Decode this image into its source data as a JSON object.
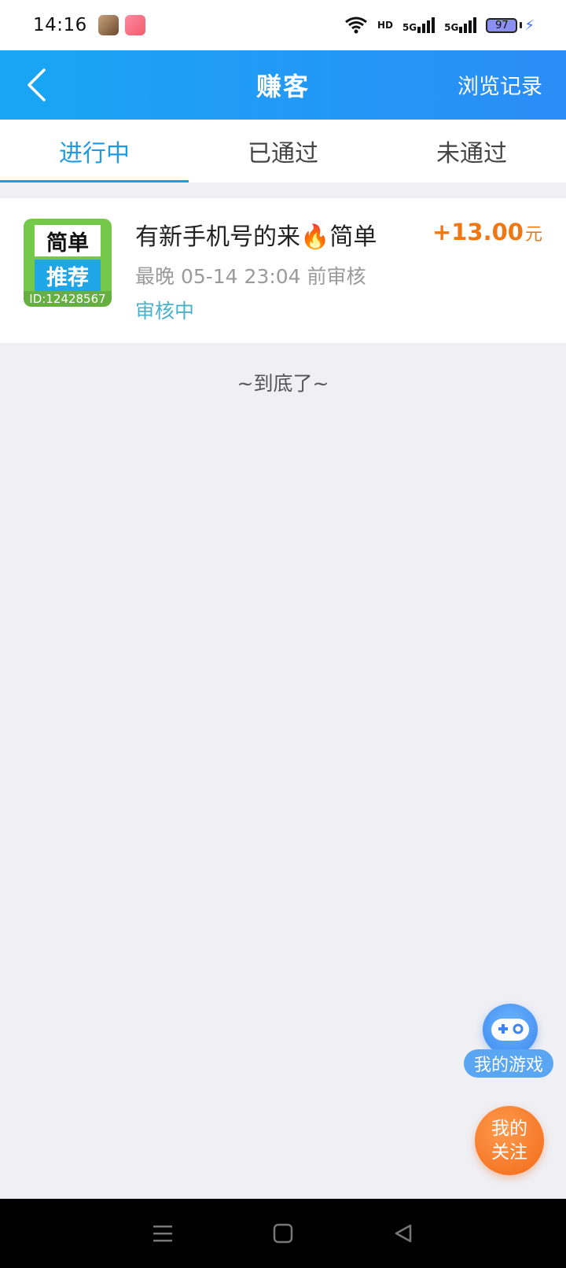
{
  "status_bar": {
    "time": "14:16",
    "network_labels": [
      "HD",
      "5G",
      "5G"
    ],
    "battery": "97"
  },
  "header": {
    "title": "赚客",
    "back_icon": "chevron-left-icon",
    "history_link": "浏览记录",
    "gradient": [
      "#19a6f4",
      "#2a8df7"
    ]
  },
  "tabs": [
    {
      "label": "进行中",
      "active": true
    },
    {
      "label": "已通过",
      "active": false
    },
    {
      "label": "未通过",
      "active": false
    }
  ],
  "task": {
    "thumb_top": "简单",
    "thumb_bottom": "推荐",
    "thumb_id": "ID:12428567",
    "title": "有新手机号的来🔥简单",
    "reward": "+13.00",
    "reward_unit": "元",
    "deadline": "最晚 05-14 23:04 前审核",
    "status": "审核中"
  },
  "end_text": "~到底了~",
  "float_buttons": {
    "my_games": "我的游戏",
    "my_follow_line1": "我的",
    "my_follow_line2": "关注"
  },
  "colors": {
    "accent": "#1e9be3",
    "reward": "#f07814",
    "status": "#4bb1c9"
  }
}
